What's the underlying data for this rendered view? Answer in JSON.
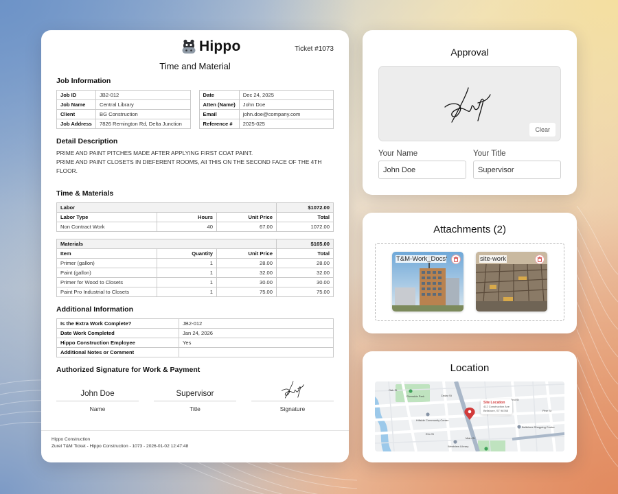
{
  "document": {
    "logo_text": "Hippo",
    "ticket": "Ticket #1073",
    "title": "Time and Material",
    "job_info": {
      "heading": "Job Information",
      "left": [
        {
          "key": "Job ID",
          "value": "JB2-012"
        },
        {
          "key": "Job Name",
          "value": "Central Library"
        },
        {
          "key": "Client",
          "value": "BG Construction"
        },
        {
          "key": "Job Address",
          "value": "7826 Remington Rd, Delta Junction"
        }
      ],
      "right": [
        {
          "key": "Date",
          "value": "Dec 24, 2025"
        },
        {
          "key": "Atten (Name)",
          "value": "John Doe"
        },
        {
          "key": "Email",
          "value": "john.doe@company.com"
        },
        {
          "key": "Reference #",
          "value": "2025-025"
        }
      ]
    },
    "detail": {
      "heading": "Detail Description",
      "lines": [
        "PRIME AND PAINT PITCHES MADE AFTER APPLYING FIRST COAT PAINT.",
        "PRIME AND PAINT CLOSETS IN DIEFERENT ROOMS, All THIS ON THE SECOND FACE OF THE 4TH",
        "FLOOR."
      ]
    },
    "time_materials": {
      "heading": "Time & Materials",
      "labor": {
        "label": "Labor",
        "total": "$1072.00",
        "columns": [
          "Labor Type",
          "Hours",
          "Unit Price",
          "Total"
        ],
        "rows": [
          [
            "Non Contract Work",
            "40",
            "67.00",
            "1072.00"
          ]
        ]
      },
      "materials": {
        "label": "Materials",
        "total": "$165.00",
        "columns": [
          "Item",
          "Quantity",
          "Unit Price",
          "Total"
        ],
        "rows": [
          [
            "Primer (gallon)",
            "1",
            "28.00",
            "28.00"
          ],
          [
            "Paint (gallon)",
            "1",
            "32.00",
            "32.00"
          ],
          [
            "Primer for Wood to Closets",
            "1",
            "30.00",
            "30.00"
          ],
          [
            "Paint Pro Industrial to Closets",
            "1",
            "75.00",
            "75.00"
          ]
        ]
      }
    },
    "additional": {
      "heading": "Additional Information",
      "rows": [
        {
          "key": "Is the Extra Work Complete?",
          "value": "JB2-012"
        },
        {
          "key": "Date Work Completed",
          "value": "Jan 24, 2026"
        },
        {
          "key": "Hippo Construction Employee",
          "value": "Yes"
        },
        {
          "key": "Additional Notes or Comment",
          "value": ""
        }
      ]
    },
    "signature": {
      "heading": "Authorized Signature for Work & Payment",
      "name_value": "John Doe",
      "name_label": "Name",
      "title_value": "Supervisor",
      "title_label": "Title",
      "signature_label": "Signature"
    },
    "footer": {
      "line1": "Hippo Construction",
      "line2": "Zurel T&M Ticket - Hippo Construction - 1073 - 2026-01-02 12:47:48"
    }
  },
  "approval": {
    "title": "Approval",
    "clear_label": "Clear",
    "name_label": "Your Name",
    "name_value": "John Doe",
    "title_label": "Your Title",
    "title_value": "Supervisor"
  },
  "attachments": {
    "title": "Attachments (2)",
    "items": [
      {
        "name": "T&M-Work_Docs"
      },
      {
        "name": "site-work"
      }
    ]
  },
  "location": {
    "title": "Location",
    "pin_title": "Site Location",
    "pin_address_1": "412 Construction Ave",
    "pin_address_2": "Bellshore, ST 98765",
    "labels": {
      "park": "Riverside Park",
      "community": "Hillside Community Center",
      "library": "Westview Library",
      "shopping": "Bellshore Shopping Center",
      "cedar": "Cedar St",
      "oak": "Oak St",
      "elm": "Elm St",
      "main": "Main St",
      "second": "2nd St",
      "pine": "Pine St"
    }
  },
  "colors": {
    "accent_red": "#d23a3a",
    "map_water": "#9cc9ea",
    "map_park": "#bfe3bf"
  }
}
